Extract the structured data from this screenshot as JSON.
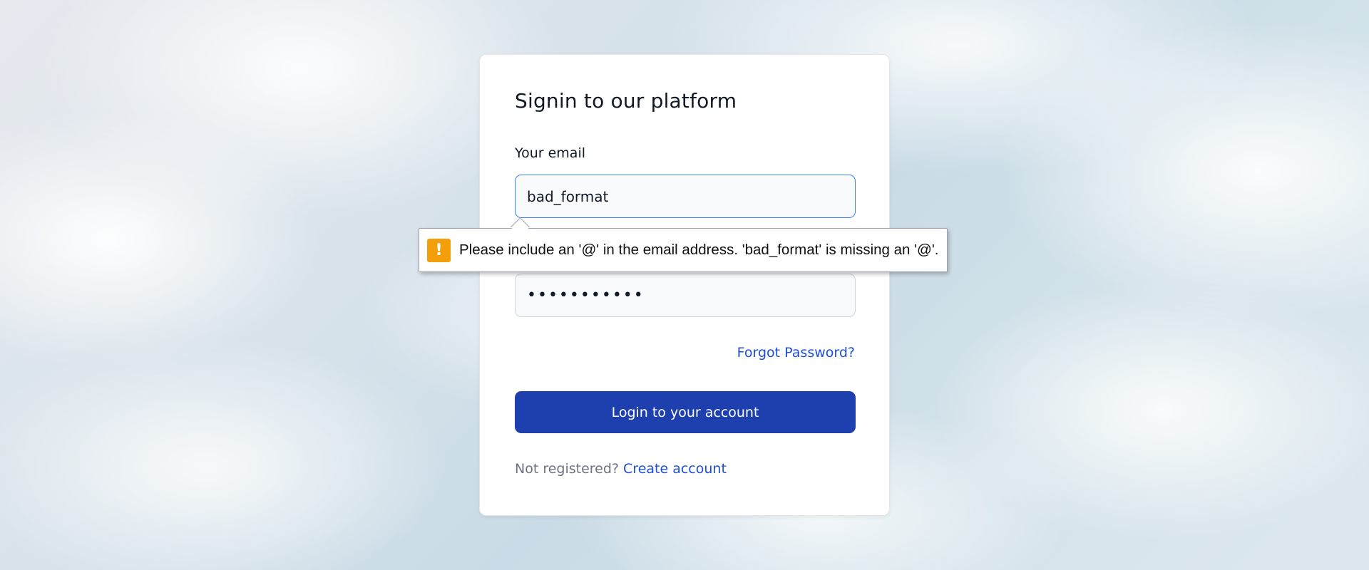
{
  "form": {
    "title": "Signin to our platform",
    "email_label": "Your email",
    "email_value": "bad_format",
    "password_value": "•••••••••••",
    "forgot_password": "Forgot Password?",
    "login_button": "Login to your account",
    "not_registered": "Not registered?",
    "create_account": "Create account"
  },
  "validation": {
    "icon": "warning-icon",
    "icon_glyph": "!",
    "message": "Please include an '@' in the email address. 'bad_format' is missing an '@'."
  },
  "colors": {
    "primary_button": "#1e40af",
    "link": "#1d4ed8",
    "warning": "#f59e0b"
  }
}
